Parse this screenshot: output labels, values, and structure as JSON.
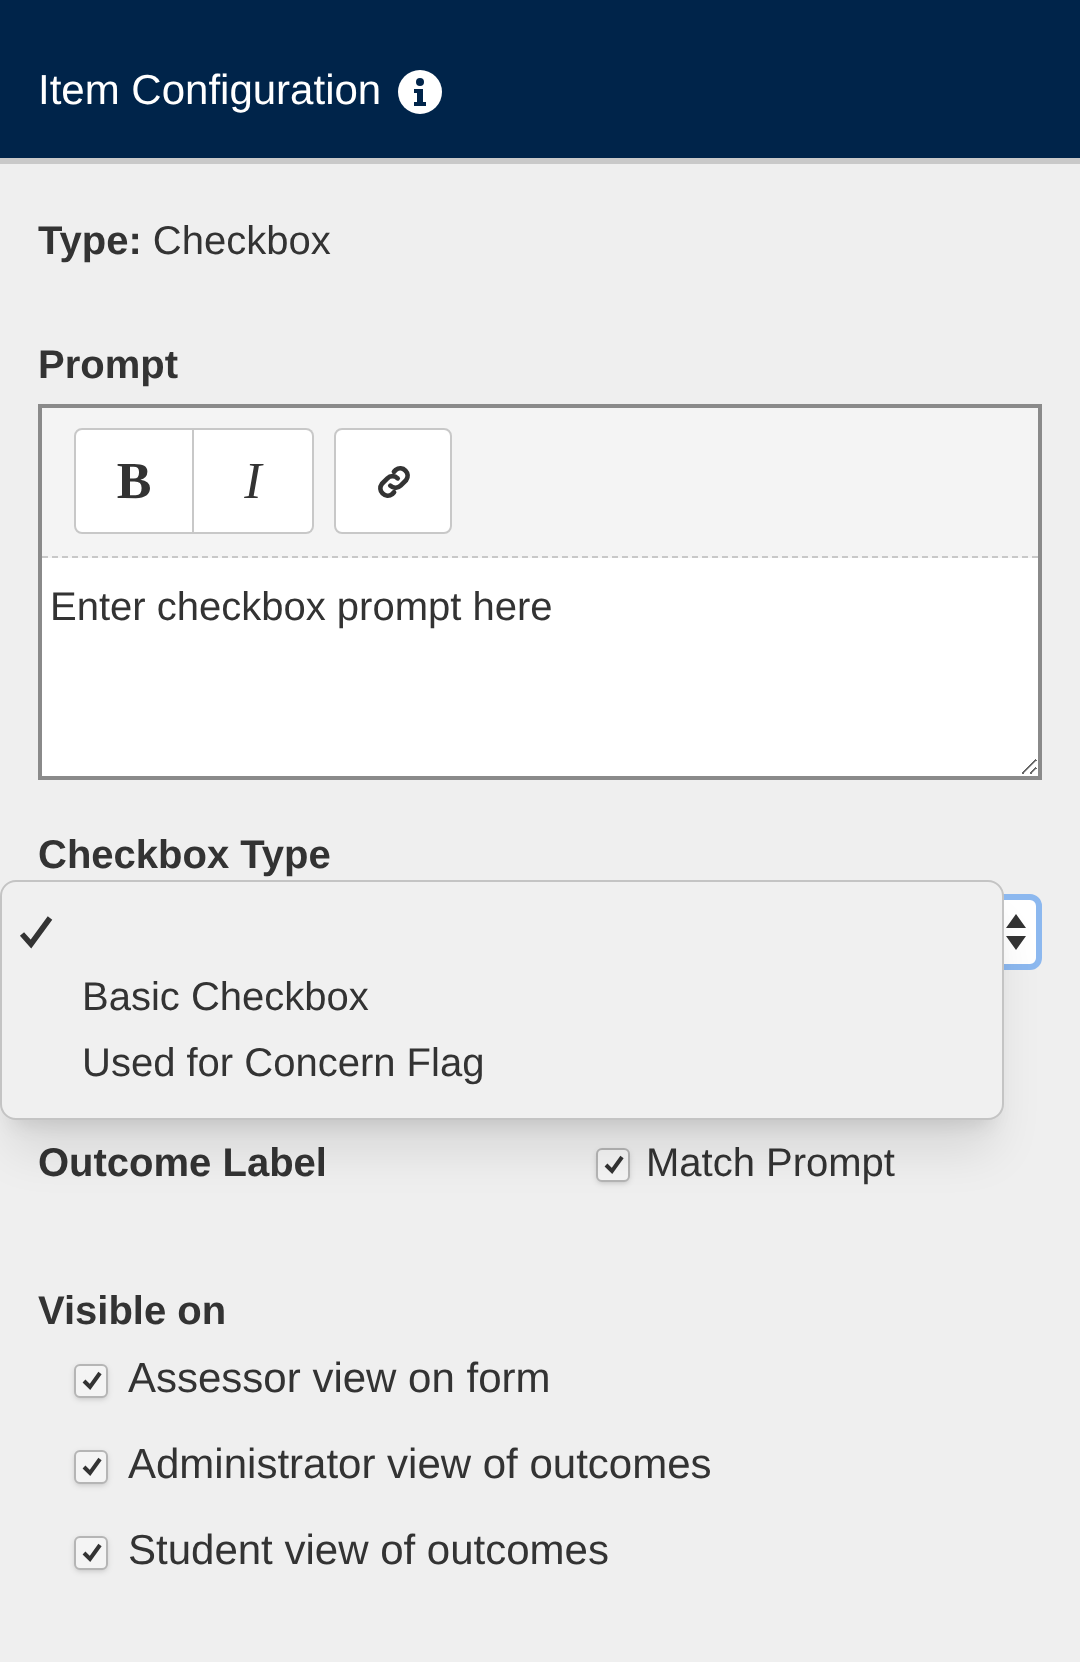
{
  "header": {
    "title": "Item Configuration"
  },
  "type": {
    "label": "Type:",
    "value": "Checkbox"
  },
  "prompt": {
    "label": "Prompt",
    "toolbar": [
      "B",
      "I"
    ],
    "placeholder": "Enter checkbox prompt here"
  },
  "checkbox_type": {
    "label": "Checkbox Type",
    "menu_open": true,
    "options": [
      {
        "selected": true
      },
      {
        "label": "Basic Checkbox",
        "selected": false
      },
      {
        "label": "Used for Concern Flag",
        "selected": false
      }
    ]
  },
  "outcome_label": {
    "label": "Outcome Label",
    "match_prompt": {
      "label": "Match Prompt",
      "checked": true
    }
  },
  "visible_on": {
    "label": "Visible on",
    "items": [
      {
        "label": "Assessor view on form",
        "checked": true
      },
      {
        "label": "Administrator view of outcomes",
        "checked": true
      },
      {
        "label": "Student view of outcomes",
        "checked": true
      }
    ]
  }
}
